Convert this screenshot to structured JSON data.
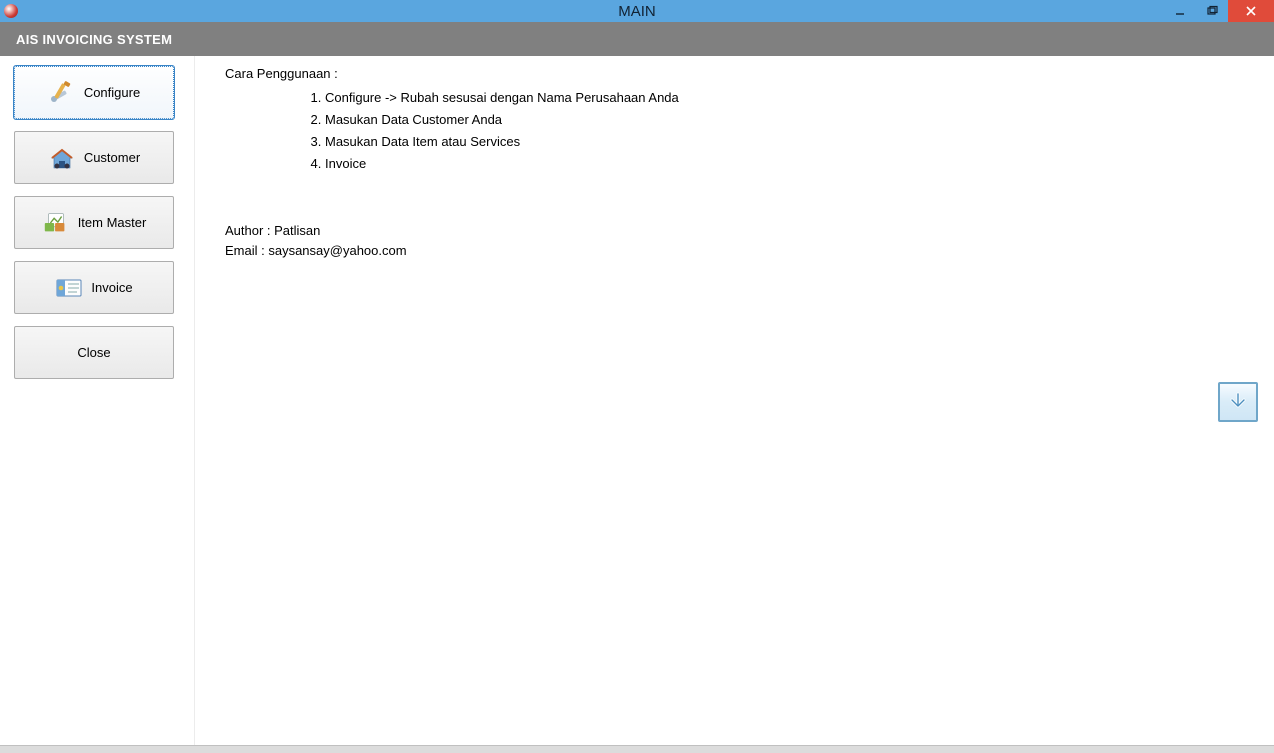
{
  "window": {
    "title": "MAIN"
  },
  "header": {
    "title": "AIS INVOICING SYSTEM"
  },
  "nav": {
    "configure": "Configure",
    "customer": "Customer",
    "item_master": "Item Master",
    "invoice": "Invoice",
    "close": "Close"
  },
  "content": {
    "heading": "Cara Penggunaan :",
    "steps": [
      "Configure -> Rubah sesusai dengan Nama Perusahaan Anda",
      "Masukan Data Customer Anda",
      "Masukan Data Item atau Services",
      "Invoice"
    ],
    "author": "Author : Patlisan",
    "email": "Email : saysansay@yahoo.com"
  }
}
